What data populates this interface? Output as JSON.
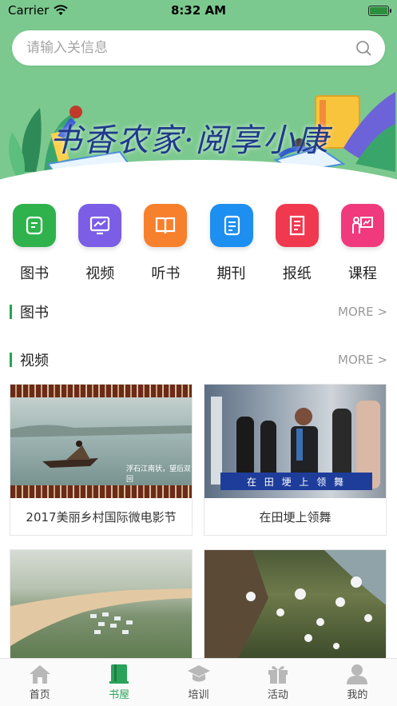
{
  "status": {
    "carrier": "Carrier",
    "time": "8:32 AM"
  },
  "search": {
    "placeholder": "请输入关信息"
  },
  "banner": {
    "title": "书香农家·阅享小康"
  },
  "categories": [
    {
      "label": "图书",
      "color": "#2fb24c",
      "icon": "book-icon"
    },
    {
      "label": "视频",
      "color": "#7b5de6",
      "icon": "monitor-chart-icon"
    },
    {
      "label": "听书",
      "color": "#f7802c",
      "icon": "open-book-icon"
    },
    {
      "label": "期刊",
      "color": "#1d8ff0",
      "icon": "journal-icon"
    },
    {
      "label": "报纸",
      "color": "#f0384f",
      "icon": "newspaper-icon"
    },
    {
      "label": "课程",
      "color": "#f03a7d",
      "icon": "teacher-board-icon"
    }
  ],
  "sections": {
    "books": {
      "title": "图书",
      "more": "MORE >"
    },
    "videos": {
      "title": "视频",
      "more": "MORE >"
    }
  },
  "videos": [
    {
      "caption": "2017美丽乡村国际微电影节",
      "overlay": "浮石江南状，望后双回"
    },
    {
      "caption": "在田埂上领舞",
      "overlay": "在 田 埂 上 领 舞"
    },
    {
      "caption": ""
    },
    {
      "caption": ""
    }
  ],
  "tabbar": [
    {
      "label": "首页",
      "icon": "home-icon",
      "active": false
    },
    {
      "label": "书屋",
      "icon": "bookshelf-icon",
      "active": true
    },
    {
      "label": "培训",
      "icon": "graduation-cap-icon",
      "active": false
    },
    {
      "label": "活动",
      "icon": "gift-icon",
      "active": false
    },
    {
      "label": "我的",
      "icon": "user-icon",
      "active": false
    }
  ],
  "colors": {
    "accent": "#2aa35a",
    "banner": "#7cc98f"
  }
}
